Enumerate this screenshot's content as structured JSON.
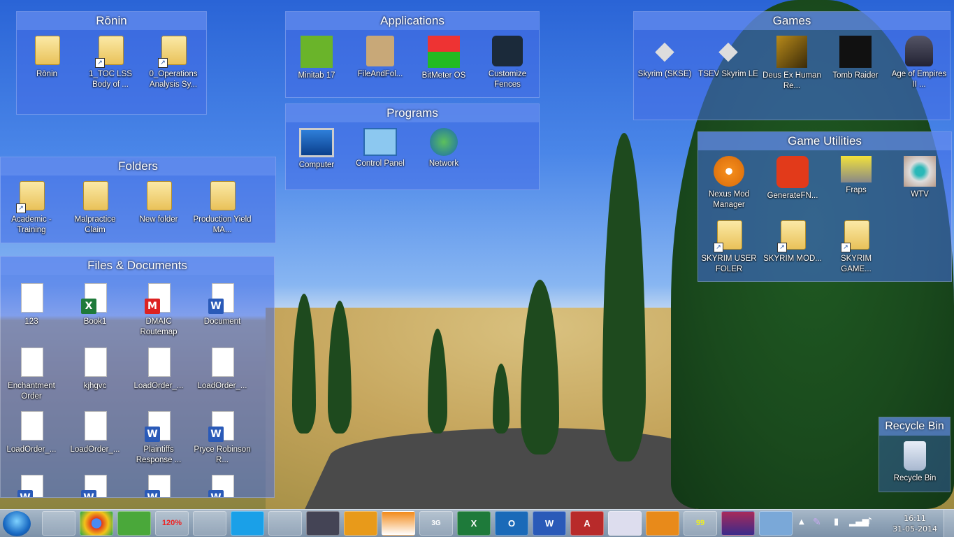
{
  "fences": {
    "ronin": {
      "title": "Rōnin",
      "items": [
        "Rōnin",
        "1_TOC LSS Body of ...",
        "0_Operations Analysis Sy..."
      ]
    },
    "applications": {
      "title": "Applications",
      "items": [
        "Minitab 17",
        "FileAndFol...",
        "BitMeter OS",
        "Customize Fences"
      ]
    },
    "programs": {
      "title": "Programs",
      "items": [
        "Computer",
        "Control Panel",
        "Network"
      ]
    },
    "games": {
      "title": "Games",
      "items": [
        "Skyrim (SKSE)",
        "TSEV Skyrim LE",
        "Deus Ex Human Re...",
        "Tomb Raider",
        "Age of Empires II ..."
      ]
    },
    "game_utilities": {
      "title": "Game Utilities",
      "items": [
        "Nexus Mod Manager",
        "GenerateFN...",
        "Fraps",
        "WTV",
        "SKYRIM USER FOLER",
        "SKYRIM MOD...",
        "SKYRIM GAME..."
      ]
    },
    "folders": {
      "title": "Folders",
      "items": [
        "Academic - Training",
        "Malpractice Claim",
        "New folder",
        "Production Yield MA..."
      ]
    },
    "files": {
      "title": "Files & Documents",
      "items": [
        "123",
        "Book1",
        "DMAIC Routemap",
        "Document",
        "Enchantment Order",
        "kjhgvc",
        "LoadOrder_...",
        "LoadOrder_...",
        "LoadOrder_...",
        "LoadOrder_...",
        "Plaintiffs Response ...",
        "Pryce Robinson R...",
        "",
        "",
        "",
        ""
      ]
    },
    "recycle": {
      "title": "Recycle Bin",
      "item": "Recycle Bin"
    }
  },
  "taskbar": {
    "apps": [
      "explorer",
      "chrome",
      "utorrent",
      "120%",
      "app",
      "skype",
      "snipping",
      "steam",
      "nexus",
      "vlc",
      "3G",
      "excel",
      "outlook",
      "word",
      "access",
      "calculator",
      "nmm",
      "fraps",
      "winrar",
      "network"
    ],
    "badges": {
      "t3": "120%",
      "t10": "3G",
      "t11": "X",
      "t12": "O",
      "t13": "W",
      "t14": "A",
      "t17": "99"
    },
    "time": "16:11",
    "date": "31-05-2014"
  },
  "colors": {
    "fence_bg": "#466ee6",
    "taskbar": "#8fa3b7"
  }
}
